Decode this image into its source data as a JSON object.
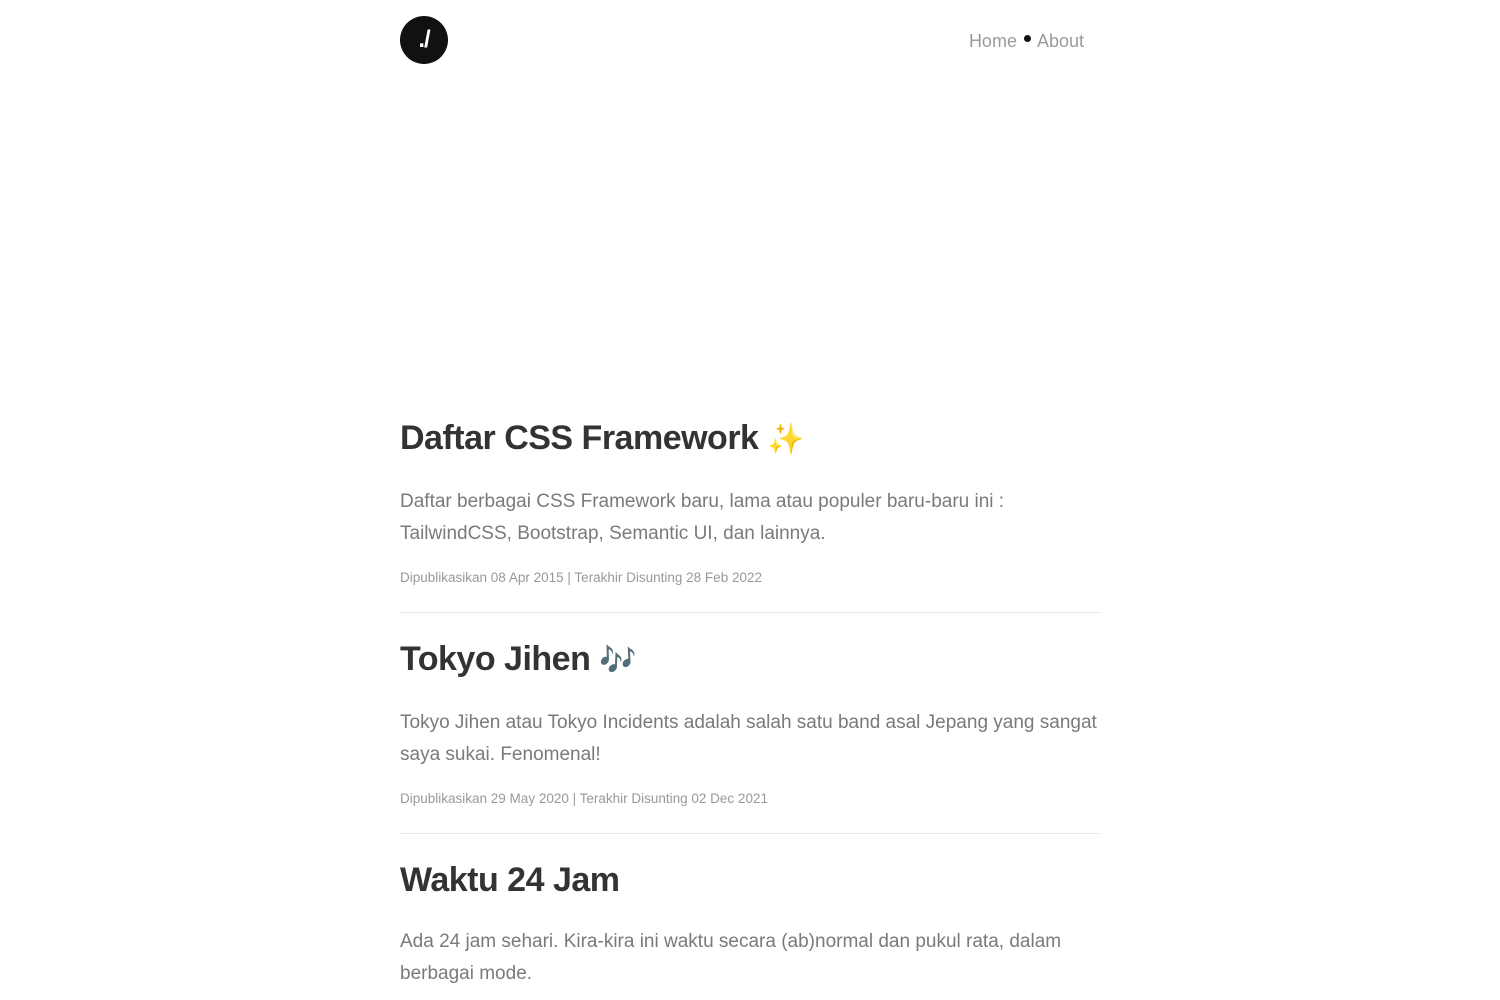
{
  "header": {
    "logo_text": "./",
    "nav": [
      {
        "label": "Home"
      },
      {
        "label": "About"
      }
    ]
  },
  "posts": [
    {
      "title": "Daftar CSS Framework",
      "emoji": "✨",
      "excerpt": "Daftar berbagai CSS Framework baru, lama atau populer baru-baru ini : TailwindCSS, Bootstrap, Semantic UI, dan lainnya.",
      "meta": "Dipublikasikan 08 Apr 2015 | Terakhir Disunting 28 Feb 2022"
    },
    {
      "title": "Tokyo Jihen",
      "emoji": "🎶",
      "excerpt": "Tokyo Jihen atau Tokyo Incidents adalah salah satu band asal Jepang yang sangat saya sukai. Fenomenal!",
      "meta": "Dipublikasikan 29 May 2020 | Terakhir Disunting 02 Dec 2021"
    },
    {
      "title": "Waktu 24 Jam",
      "emoji": "",
      "excerpt": "Ada 24 jam sehari. Kira-kira ini waktu secara (ab)normal dan pukul rata, dalam berbagai mode.",
      "meta": ""
    }
  ],
  "colors": {
    "logo_bg": "#111111",
    "title": "#333333",
    "excerpt": "#7a7a7a",
    "meta": "#999999",
    "nav_link": "#9a9a9a",
    "divider": "#e8e8e8"
  }
}
